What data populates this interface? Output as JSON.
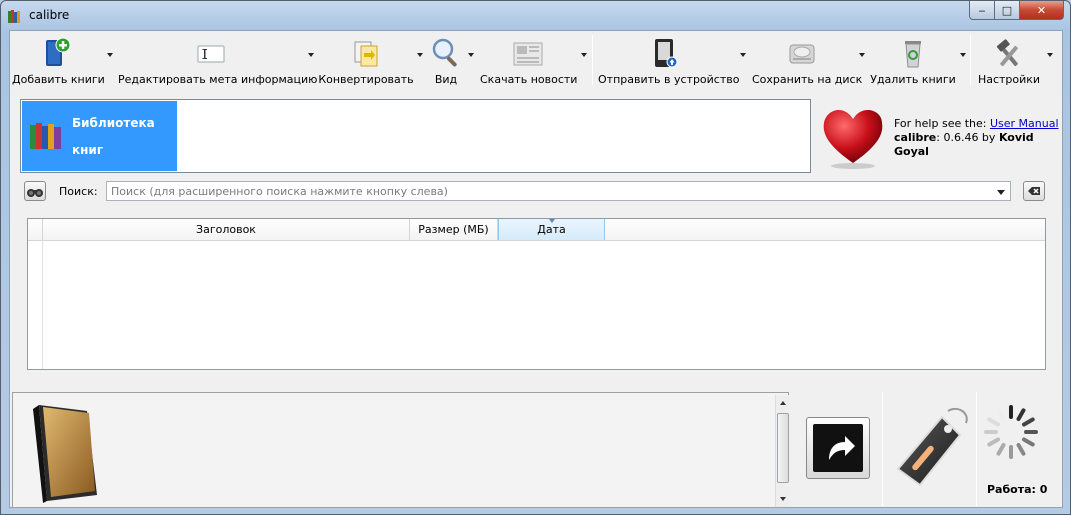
{
  "window": {
    "title": "calibre"
  },
  "toolbar": {
    "add_books": "Добавить книги",
    "edit_meta": "Редактировать мета информацию",
    "convert": "Конвертировать",
    "view": "Вид",
    "fetch_news": "Скачать новости",
    "send_device": "Отправить в устройство",
    "save_disk": "Сохранить на диск",
    "remove_books": "Удалить книги",
    "preferences": "Настройки"
  },
  "library": {
    "line1": "Библиотека",
    "line2": "книг"
  },
  "help": {
    "prefix": "For help see the: ",
    "link": "User Manual",
    "app": "calibre",
    "version": ": 0.6.46 by ",
    "author": "Kovid Goyal"
  },
  "search": {
    "label": "Поиск:",
    "placeholder": "Поиск (для расширенного поиска нажмите кнопку слева)"
  },
  "table": {
    "columns": [
      "Заголовок",
      "Размер (МБ)",
      "Дата"
    ],
    "sorted_column": "Дата"
  },
  "status": {
    "jobs": "Работа: 0"
  }
}
